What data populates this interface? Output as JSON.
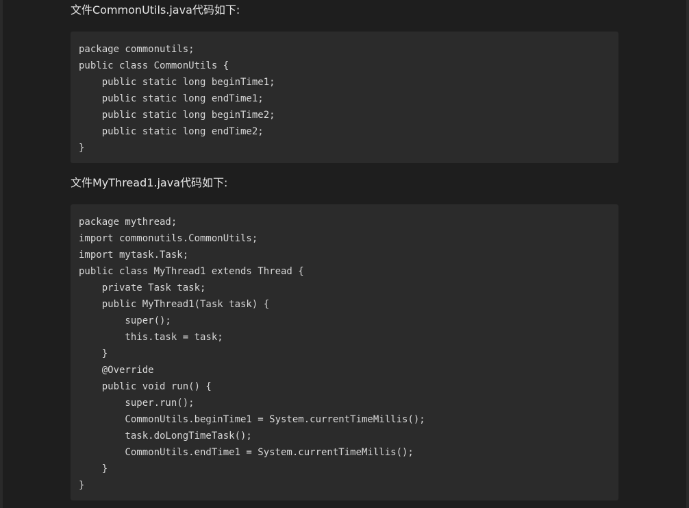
{
  "article": {
    "para1": "文件CommonUtils.java代码如下:",
    "code1": "package commonutils;\npublic class CommonUtils {\n    public static long beginTime1;\n    public static long endTime1;\n    public static long beginTime2;\n    public static long endTime2;\n}",
    "para2": "文件MyThread1.java代码如下:",
    "code2": "package mythread;\nimport commonutils.CommonUtils;\nimport mytask.Task;\npublic class MyThread1 extends Thread {\n    private Task task;\n    public MyThread1(Task task) {\n        super();\n        this.task = task;\n    }\n    @Override\n    public void run() {\n        super.run();\n        CommonUtils.beginTime1 = System.currentTimeMillis();\n        task.doLongTimeTask();\n        CommonUtils.endTime1 = System.currentTimeMillis();\n    }\n}"
  },
  "colors": {
    "page_background": "#1e1e1e",
    "code_background": "#2b2b2b",
    "text": "#e6e6e6"
  }
}
